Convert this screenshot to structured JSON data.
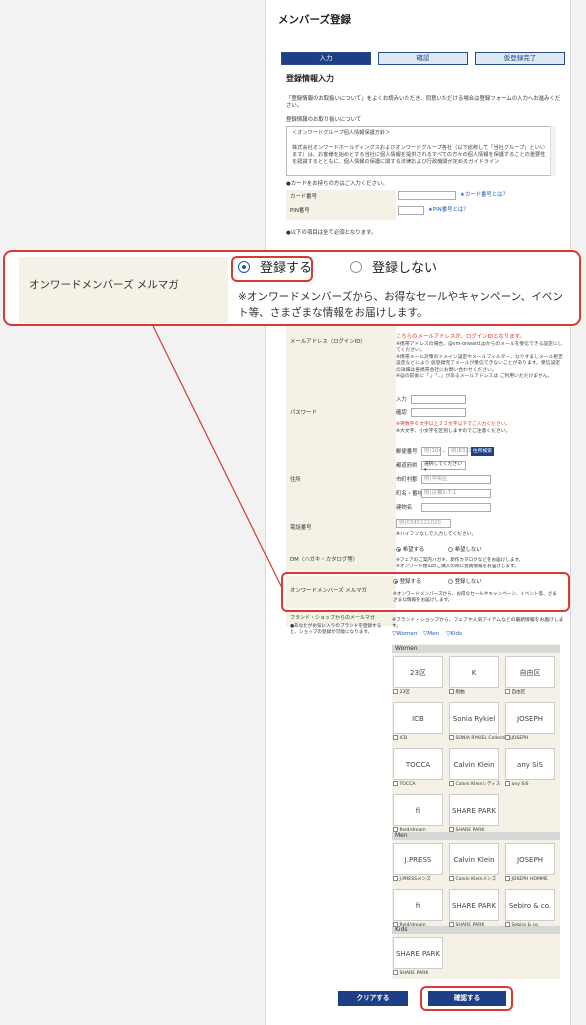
{
  "page": {
    "title": "メンバーズ登録",
    "steps": [
      "入力",
      "確認",
      "仮登録完了"
    ],
    "section_title": "登録情報入力",
    "intro": "「登録情報のお取扱いについて」をよくお読みいただき、同意いただける場合は登録フォームの入力へお進みください。",
    "policy_heading": "登録情報のお取り扱いについて",
    "policy_text_1": "＜オンワードグループ個人情報保護方針＞",
    "policy_text_2": "株式会社オンワードホールディングスおよびオンワードグループ各社（以下総称して「当社グループ」といいます）は、お客様を始めとする当社に個人情報を提供されるすべての方々の個人情報を保護することの重要性を認識するとともに、個人情報の保護に関する法律および行政機関が定めるガイドライン"
  },
  "card": {
    "note": "●カードをお持ちの方はご入力ください。",
    "card_label": "カード番号",
    "card_link": "★カード番号とは？",
    "pin_label": "PIN番号",
    "pin_link": "★PIN番号とは？"
  },
  "required_note": "●以下の項目は全て必須となります。",
  "zoom": {
    "label": "オンワードメンバーズ メルマガ",
    "opt_yes": "登録する",
    "opt_no": "登録しない",
    "note": "※オンワードメンバーズから、お得なセールやキャンペーン、イベント等、さまざまな情報をお届けします。"
  },
  "email": {
    "label": "メールアドレス（ログインID）",
    "warn": "こちらのメールアドレスが、ログインIDとなります。",
    "note1": "※携帯アドレスの場合、@vm-onward.jpからのメールを受信できる設定にしてください。",
    "note2": "※携帯メール対策のドメイン設定やメールフィルター、なりすましメール拒否設定などにより 仮登録完了メールが受信できないことがあります。受信設定の詳細は各携帯会社にお問い合わせください。",
    "note3": "※@の前後に「.」「..」があるメールアドレスは ご利用いただけません。"
  },
  "password": {
    "label": "パスワード",
    "input_label": "入力",
    "confirm_label": "確認",
    "rule": "※英数字６文字以上２２文字以下でご入力ください。",
    "case": "※大文字、小文字を区別しますのでご注意ください。"
  },
  "address": {
    "label": "住所",
    "zip_label": "郵便番号",
    "zip1_ph": "例)104",
    "zip2_ph": "例)8329",
    "zip_button": "住所検索",
    "pref_label": "都道府県",
    "pref_value": "選択してください",
    "city_label": "市町村郡",
    "city_ph": "例)中央区",
    "street_label": "町名・番地",
    "street_ph": "例)京橋1-7-1",
    "bldg_label": "建物名"
  },
  "phone": {
    "label": "電話番号",
    "ph": "例)0345121020",
    "note": "※ハイフンなしで入力してください。"
  },
  "dm": {
    "label": "DM（ハガキ・カタログ等）",
    "yes": "希望する",
    "no": "希望しない",
    "note1": "※フェアのご案内ハガキ、新作カタログなどをお届けします。",
    "note2": "※オンワード樫山のご購入の際に会員情報をお届けします。"
  },
  "mag": {
    "label": "オンワードメンバーズ メルマガ",
    "yes": "登録する",
    "no": "登録しない",
    "note": "※オンワードメンバーズから、お得なセールやキャンペーン、イベント等、さまざまな情報をお届けします。"
  },
  "brands": {
    "label": "ブランド・ショップからのメールマガ",
    "label_note": "●あなたがお気に入りのブランドを登録すると、ショップの登録が可能になります。",
    "note": "※ブランド・ショップから、フェアや人気アイテムなどの最新情報をお届けします。",
    "filters": [
      "▽Women",
      "▽Men",
      "▽Kids"
    ],
    "women_header": "Women",
    "men_header": "Men",
    "kids_header": "Kids",
    "women": [
      {
        "logo": "23区",
        "name": "23区"
      },
      {
        "logo": "K",
        "name": "組曲"
      },
      {
        "logo": "自由区",
        "name": "自由区"
      },
      {
        "logo": "ICB",
        "name": "ICB"
      },
      {
        "logo": "Sonia Rykiel",
        "name": "SONIA RYKIEL Collection"
      },
      {
        "logo": "JOSEPH",
        "name": "JOSEPH"
      },
      {
        "logo": "TOCCA",
        "name": "TOCCA"
      },
      {
        "logo": "Calvin Klein",
        "name": "Calvin Kleinレディス"
      },
      {
        "logo": "any SiS",
        "name": "any SiS"
      },
      {
        "logo": "fi",
        "name": "field/dream"
      },
      {
        "logo": "SHARE PARK",
        "name": "SHARE PARK"
      }
    ],
    "men": [
      {
        "logo": "J.PRESS",
        "name": "J.PRESSメンズ"
      },
      {
        "logo": "Calvin Klein",
        "name": "Calvin Kleinメンズ"
      },
      {
        "logo": "JOSEPH",
        "name": "JOSEPH HOMME"
      },
      {
        "logo": "fi",
        "name": "field/dream"
      },
      {
        "logo": "SHARE PARK",
        "name": "SHARE PARK"
      },
      {
        "logo": "Sebiro & co.",
        "name": "Sebiro & co."
      }
    ],
    "kids": [
      {
        "logo": "SHARE PARK",
        "name": "SHARE PARK"
      }
    ]
  },
  "buttons": {
    "clear": "クリアする",
    "confirm": "確認する"
  },
  "colors": {
    "accent": "#1e3f88",
    "highlight": "#d93a34",
    "label_bg": "#f6f1e7"
  }
}
